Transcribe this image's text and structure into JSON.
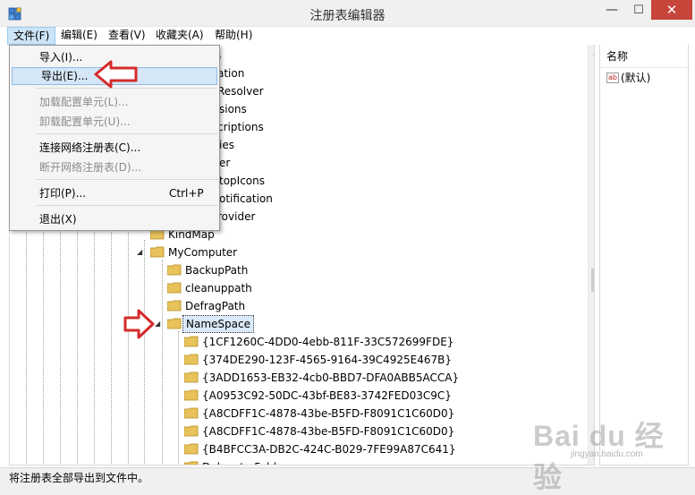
{
  "window": {
    "title": "注册表编辑器"
  },
  "window_controls": {
    "minimize": "—",
    "maximize": "☐",
    "close": "✕"
  },
  "menubar": [
    {
      "label": "文件(F)"
    },
    {
      "label": "编辑(E)"
    },
    {
      "label": "查看(V)"
    },
    {
      "label": "收藏夹(A)"
    },
    {
      "label": "帮助(H)"
    }
  ],
  "file_menu": {
    "items": [
      {
        "label": "导入(I)...",
        "disabled": false
      },
      {
        "label": "导出(E)...",
        "disabled": false,
        "highlighted": true
      },
      {
        "label": "加载配置单元(L)...",
        "disabled": true
      },
      {
        "label": "卸载配置单元(U)...",
        "disabled": true
      },
      {
        "label": "连接网络注册表(C)...",
        "disabled": false
      },
      {
        "label": "断开网络注册表(D)...",
        "disabled": true
      },
      {
        "label": "打印(P)...",
        "disabled": false,
        "shortcut": "Ctrl+P"
      },
      {
        "label": "退出(X)",
        "disabled": false
      }
    ]
  },
  "tree": {
    "partial_rows": [
      "s",
      "ation",
      "Resolver",
      "sions",
      "criptions",
      "ies",
      "er",
      "topIcons",
      "otification",
      "rovider"
    ],
    "kindmap": "KindMap",
    "mycomputer": "MyComputer",
    "children": [
      "BackupPath",
      "cleanuppath",
      "DefragPath"
    ],
    "namespace": "NameSpace",
    "guids": [
      "{1CF1260C-4DD0-4ebb-811F-33C572699FDE}",
      "{374DE290-123F-4565-9164-39C4925E467B}",
      "{3ADD1653-EB32-4cb0-BBD7-DFA0ABB5ACCA}",
      "{A0953C92-50DC-43bf-BE83-3742FED03C9C}",
      "{A8CDFF1C-4878-43be-B5FD-F8091C1C60D0}",
      "{A8CDFF1C-4878-43be-B5FD-F8091C1C60D0}",
      "{B4BFCC3A-DB2C-424C-B029-7FE99A87C641}"
    ],
    "cut_row": "Delegate Folders"
  },
  "values_pane": {
    "header": "名称",
    "default_value": "(默认)",
    "value_icon_text": "ab"
  },
  "status": {
    "text": "将注册表全部导出到文件中。"
  },
  "watermark": {
    "main": "Bai du 经验",
    "sub": "jingyan.baidu.com"
  },
  "colors": {
    "menu_highlight": "#cce4f7",
    "item_hover": "#d5e6f6",
    "close_button": "#c7453b",
    "annotation_arrow": "#d42b2b",
    "folder": "#e8c25a"
  }
}
